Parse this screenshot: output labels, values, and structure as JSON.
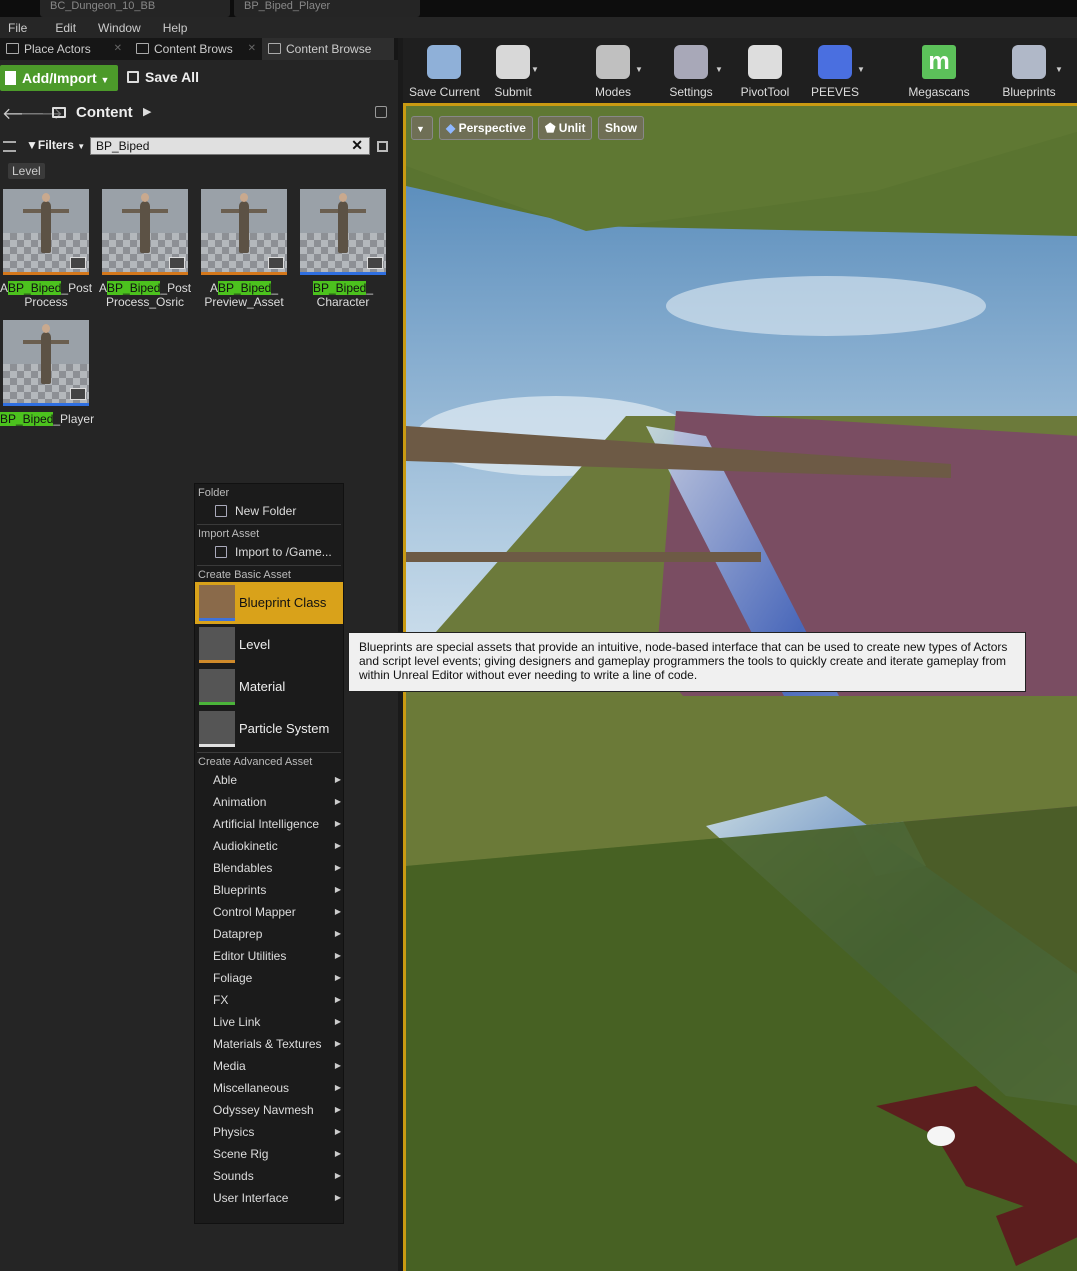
{
  "window": {
    "doc_tabs": [
      "BC_Dungeon_10_BB",
      "BP_Biped_Player"
    ]
  },
  "menubar": [
    "File",
    "Edit",
    "Window",
    "Help"
  ],
  "left_tabs": [
    {
      "label": "Place Actors"
    },
    {
      "label": "Content Brows"
    },
    {
      "label": "Content Browse"
    }
  ],
  "content_browser": {
    "add_import": "Add/Import",
    "save_all": "Save All",
    "path": "Content",
    "filters": "Filters",
    "search_value": "BP_Biped",
    "filter_chip": "Level",
    "assets": [
      {
        "pre": "A",
        "hl": "BP_Biped",
        "post": "_Post",
        "line2": "Process",
        "strip": "#d4781c"
      },
      {
        "pre": "A",
        "hl": "BP_Biped",
        "post": "_Post",
        "line2": "Process_Osric",
        "strip": "#d4781c"
      },
      {
        "pre": "A",
        "hl": "BP_Biped",
        "post": "_",
        "line2": "Preview_Asset",
        "strip": "#d4781c"
      },
      {
        "pre": "",
        "hl": "BP_Biped",
        "post": "_",
        "line2": "Character",
        "strip": "#2f6fe0"
      },
      {
        "pre": "",
        "hl": "BP_Biped",
        "post": "_Player",
        "line2": "",
        "strip": "#2f6fe0"
      }
    ]
  },
  "toolbar": {
    "buttons": [
      {
        "label": "Save Current",
        "icon": "save-disk-icon"
      },
      {
        "label": "Submit",
        "icon": "source-control-icon"
      },
      {
        "label": "Modes",
        "icon": "modes-tools-icon"
      },
      {
        "label": "Settings",
        "icon": "settings-gears-icon"
      },
      {
        "label": "PivotTool",
        "icon": "pivot-cube-icon"
      },
      {
        "label": "PEEVES",
        "icon": "peeves-frog-icon"
      },
      {
        "label": "Megascans",
        "icon": "megascans-m-icon"
      },
      {
        "label": "Blueprints",
        "icon": "blueprints-gamepad-icon"
      }
    ]
  },
  "viewport": {
    "perspective": "Perspective",
    "unlit": "Unlit",
    "show": "Show"
  },
  "context_menu": {
    "folder_header": "Folder",
    "new_folder": "New Folder",
    "import_header": "Import Asset",
    "import_to": "Import to /Game...",
    "basic_header": "Create Basic Asset",
    "basic": [
      {
        "label": "Blueprint Class",
        "color": "#3f72d9"
      },
      {
        "label": "Level",
        "color": "#d08a2a"
      },
      {
        "label": "Material",
        "color": "#4bb43a"
      },
      {
        "label": "Particle System",
        "color": "#e0e0e0"
      }
    ],
    "advanced_header": "Create Advanced Asset",
    "advanced": [
      "Able",
      "Animation",
      "Artificial Intelligence",
      "Audiokinetic",
      "Blendables",
      "Blueprints",
      "Control Mapper",
      "Dataprep",
      "Editor Utilities",
      "Foliage",
      "FX",
      "Live Link",
      "Materials & Textures",
      "Media",
      "Miscellaneous",
      "Odyssey Navmesh",
      "Physics",
      "Scene Rig",
      "Sounds",
      "User Interface"
    ]
  },
  "tooltip": "Blueprints are special assets that provide an intuitive, node-based interface that can be used to create new types of Actors and script level events; giving designers and gameplay programmers the tools to quickly create and iterate gameplay from within Unreal Editor without ever needing to write a line of code."
}
